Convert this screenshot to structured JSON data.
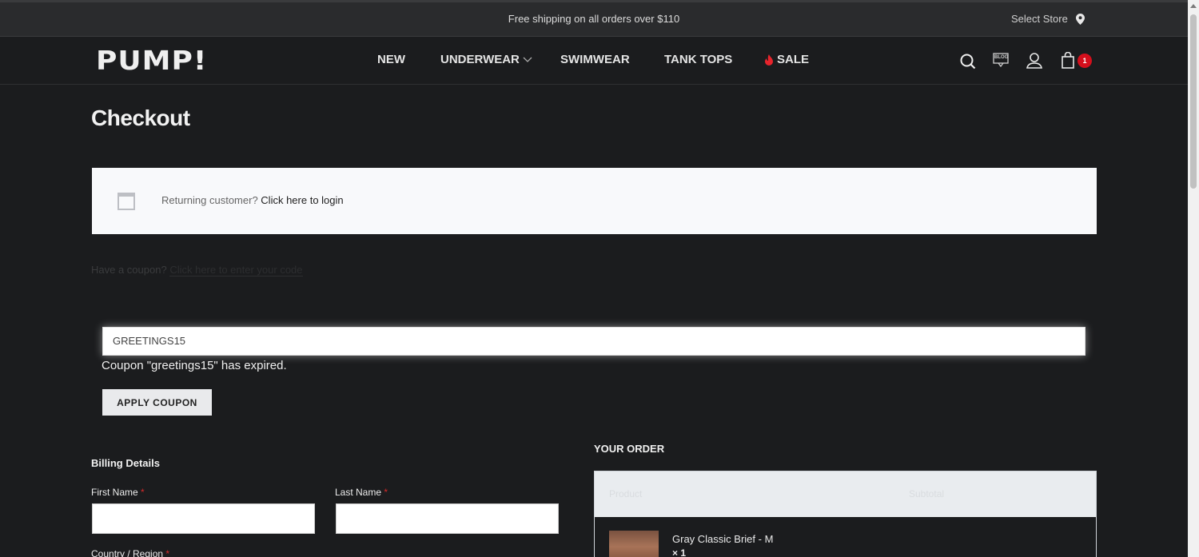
{
  "topbar": {
    "shipping_text": "Free shipping on all orders over $110",
    "select_store_label": "Select Store",
    "store_icon": "map-pin-icon"
  },
  "header": {
    "logo": "PUMP!",
    "nav": [
      {
        "label": "NEW"
      },
      {
        "label": "UNDERWEAR"
      },
      {
        "label": "SWIMWEAR"
      },
      {
        "label": "TANK TOPS"
      },
      {
        "label": "SALE"
      }
    ],
    "icons": [
      "search-icon",
      "blog-icon",
      "user-icon",
      "cart-icon"
    ],
    "blog_label": "BLOG",
    "cart_count": "1",
    "accent": "#d40f1c"
  },
  "checkout": {
    "title": "Checkout",
    "returning_prefix": "Returning customer?",
    "returning_link": "Click here to login",
    "coupon_prefix": "Have a coupon?",
    "coupon_link": "Click here to enter your code",
    "coupon_value": "GREETINGS15",
    "coupon_message": "Coupon \"greetings15\" has expired.",
    "apply_label": "APPLY COUPON"
  },
  "billing": {
    "title": "Billing Details",
    "first_name_label": "First Name",
    "last_name_label": "Last Name",
    "country_label": "Country / Region",
    "required_mark": "*"
  },
  "order": {
    "title": "YOUR ORDER",
    "col_product": "Product",
    "col_subtotal": "Subtotal",
    "item_name": "Gray Classic Brief - M",
    "item_qty": "× 1"
  }
}
